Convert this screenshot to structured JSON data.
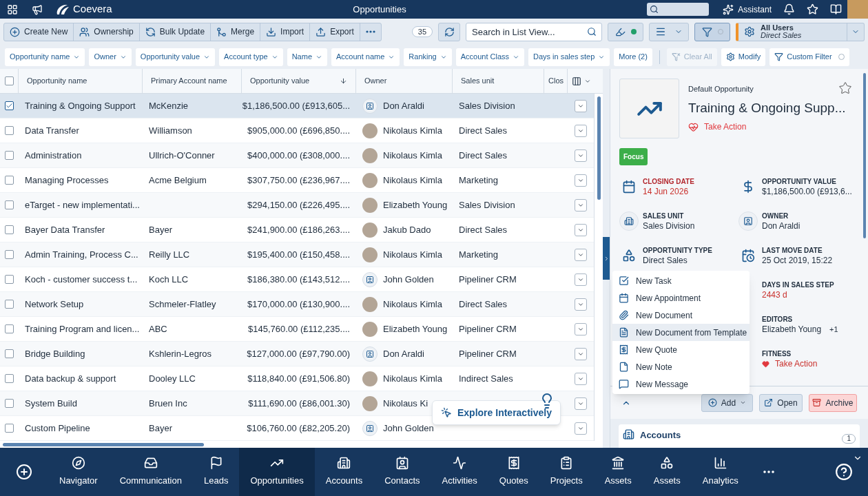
{
  "topbar": {
    "brand": "Coevera",
    "title": "Opportunities",
    "assistant": "Assistant"
  },
  "toolbar": {
    "actions": [
      "Create New",
      "Ownership",
      "Bulk Update",
      "Merge",
      "Import",
      "Export"
    ],
    "count": "35",
    "search": {
      "placeholder": "Search in List View..."
    },
    "highlight_on": true,
    "filter_active": true,
    "profile": {
      "title": "All Users",
      "subtitle": "Direct Sales"
    }
  },
  "filters": [
    "Opportunity name",
    "Owner",
    "Opportunity value",
    "Account type",
    "Name",
    "Account name",
    "Ranking",
    "Account Class",
    "Days in sales step"
  ],
  "filter_more": "More (2)",
  "filter_actions": [
    {
      "label": "Clear All",
      "disabled": true
    },
    {
      "label": "Modify",
      "disabled": false
    },
    {
      "label": "Custom Filter",
      "disabled": false
    }
  ],
  "table": {
    "header_checked": false,
    "columns": [
      "Opportunity name",
      "Primary Account name",
      "Opportunity value",
      "Owner",
      "Sales unit",
      "Clos"
    ],
    "rows": [
      {
        "name": "Training & Ongoing Support",
        "account": "McKenzie",
        "value": "$1,186,500.00 (£913,605...",
        "owner": "Don Araldi",
        "kind": "badge",
        "unit": "Sales Division",
        "checked": true,
        "selected": true
      },
      {
        "name": "Data Transfer",
        "account": "Williamson",
        "value": "$905,000.00 (£696,850....",
        "owner": "Nikolaus Kimla",
        "kind": "photo",
        "unit": "Direct Sales",
        "checked": false,
        "selected": false
      },
      {
        "name": "Administration",
        "account": "Ullrich-O'Conner",
        "value": "$400,000.00 (£308,000....",
        "owner": "Nikolaus Kimla",
        "kind": "photo",
        "unit": "Direct Sales",
        "checked": false,
        "selected": false
      },
      {
        "name": "Managing Processes",
        "account": "Acme Belgium",
        "value": "$307,750.00 (£236,967....",
        "owner": "Nikolaus Kimla",
        "kind": "photo",
        "unit": "Marketing",
        "checked": false,
        "selected": false
      },
      {
        "name": "eTarget - new implementati...",
        "value": "$294,150.00 (£226,495....",
        "owner": "Elizabeth Young",
        "kind": "photo",
        "unit": "Sales Division",
        "checked": false,
        "selected": false
      },
      {
        "name": "Bayer Data Transfer",
        "account": "Bayer",
        "value": "$241,900.00 (£186,263....",
        "owner": "Jakub Dado",
        "kind": "photo",
        "unit": "Direct Sales",
        "checked": false,
        "selected": false
      },
      {
        "name": "Admin Training, Process C...",
        "account": "Reilly LLC",
        "value": "$195,400.00 (£150,458....",
        "owner": "Nikolaus Kimla",
        "kind": "photo",
        "unit": "Marketing",
        "checked": false,
        "selected": false
      },
      {
        "name": "Koch - customer success t...",
        "account": "Koch LLC",
        "value": "$186,380.00 (£143,512....",
        "owner": "John Golden",
        "kind": "badge",
        "unit": "Pipeliner CRM",
        "checked": false,
        "selected": false
      },
      {
        "name": "Network Setup",
        "account": "Schmeler-Flatley",
        "value": "$170,000.00 (£130,900....",
        "owner": "Nikolaus Kimla",
        "kind": "photo",
        "unit": "Direct Sales",
        "checked": false,
        "selected": false
      },
      {
        "name": "Training Program and licen...",
        "account": "ABC",
        "value": "$145,760.00 (£112,235....",
        "owner": "Elizabeth Young",
        "kind": "photo",
        "unit": "Pipeliner CRM",
        "checked": false,
        "selected": false
      },
      {
        "name": "Bridge Building",
        "account": "Kshlerin-Legros",
        "value": "$127,000.00 (£97,790.00)",
        "owner": "Don Araldi",
        "kind": "badge",
        "unit": "Pipeliner CRM",
        "checked": false,
        "selected": false
      },
      {
        "name": "Data backup & support",
        "account": "Dooley LLC",
        "value": "$118,840.00 (£91,506.80)",
        "owner": "Nikolaus Kimla",
        "kind": "photo",
        "unit": "Indirect Sales",
        "checked": false,
        "selected": false
      },
      {
        "name": "System Build",
        "account": "Bruen Inc",
        "value": "$111,690.00 (£86,001.30)",
        "owner": "Nikolaus Ki",
        "kind": "photo",
        "checked": false,
        "selected": false
      },
      {
        "name": "Custom Pipeline",
        "account": "Bayer",
        "value": "$106,760.00 (£82,205.20)",
        "owner": "John Golden",
        "kind": "badge",
        "checked": false,
        "selected": false
      }
    ]
  },
  "explore": "Explore Interactively",
  "detail": {
    "type": "Default Opportunity",
    "title": "Training & Ongoing Supp...",
    "health": "Take Action",
    "tag": "Focus",
    "fields": [
      {
        "label": "CLOSING DATE",
        "value": "14 Jun 2026",
        "label_alert": true,
        "value_alert": true
      },
      {
        "label": "OPPORTUNITY VALUE",
        "value": "$1,186,500.00 (£913,6...",
        "label_alert": false,
        "value_alert": false
      },
      {
        "label": "SALES UNIT",
        "value": "Sales Division",
        "label_alert": false,
        "value_alert": false
      },
      {
        "label": "OWNER",
        "value": "Don Araldi",
        "label_alert": false,
        "value_alert": false
      },
      {
        "label": "OPPORTUNITY TYPE",
        "value": "Direct Sales",
        "label_alert": false,
        "value_alert": false
      },
      {
        "label": "LAST MOVE DATE",
        "value": "25 Oct 2019, 15:22",
        "label_alert": false,
        "value_alert": false
      },
      {
        "label": "DAYS IN SALES STEP",
        "value": "2443 d",
        "label_alert": false,
        "value_alert": true
      },
      {
        "label": "EDITORS",
        "value": "Elizabeth Young",
        "extra": "+1",
        "label_alert": false,
        "value_alert": false
      },
      {
        "label": "FITNESS",
        "value": "Take Action",
        "label_alert": false,
        "value_alert": true
      }
    ],
    "menu": [
      {
        "label": "New Task",
        "selected": false
      },
      {
        "label": "New Appointment",
        "selected": false
      },
      {
        "label": "New Document",
        "selected": false
      },
      {
        "label": "New Document from Template",
        "selected": true
      },
      {
        "label": "New Quote",
        "selected": false
      },
      {
        "label": "New Note",
        "selected": false
      },
      {
        "label": "New Message",
        "selected": false
      }
    ],
    "buttons": [
      "Add",
      "Open",
      "Archive"
    ],
    "card": {
      "title": "Accounts",
      "count": "1"
    }
  },
  "nav": [
    {
      "label": "Navigator",
      "selected": false
    },
    {
      "label": "Communication",
      "selected": false
    },
    {
      "label": "Leads",
      "selected": false
    },
    {
      "label": "Opportunities",
      "selected": true
    },
    {
      "label": "Accounts",
      "selected": false
    },
    {
      "label": "Contacts",
      "selected": false
    },
    {
      "label": "Activities",
      "selected": false
    },
    {
      "label": "Quotes",
      "selected": false
    },
    {
      "label": "Projects",
      "selected": false
    },
    {
      "label": "Assets",
      "selected": false
    },
    {
      "label": "Assets",
      "selected": false
    },
    {
      "label": "Analytics",
      "selected": false
    }
  ]
}
